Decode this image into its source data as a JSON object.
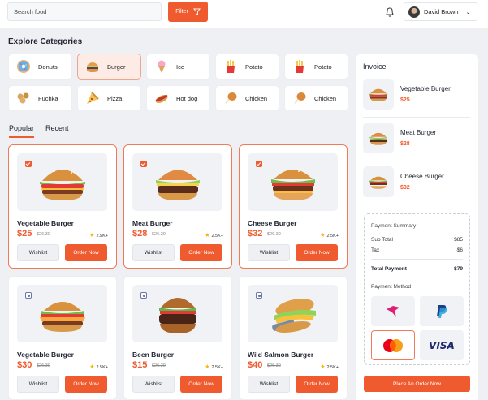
{
  "header": {
    "search_placeholder": "Search food",
    "filter_label": "Filter",
    "user_name": "David Brown"
  },
  "categories": {
    "title": "Explore Categories",
    "items": [
      {
        "label": "Donuts",
        "icon": "donut-icon",
        "active": false
      },
      {
        "label": "Burger",
        "icon": "burger-icon",
        "active": true
      },
      {
        "label": "Ice",
        "icon": "ice-cream-icon",
        "active": false
      },
      {
        "label": "Potato",
        "icon": "fries-icon",
        "active": false
      },
      {
        "label": "Potato",
        "icon": "fries-icon",
        "active": false
      },
      {
        "label": "Fuchka",
        "icon": "fuchka-icon",
        "active": false
      },
      {
        "label": "Pizza",
        "icon": "pizza-icon",
        "active": false
      },
      {
        "label": "Hot dog",
        "icon": "hot-dog-icon",
        "active": false
      },
      {
        "label": "Chicken",
        "icon": "chicken-icon",
        "active": false
      },
      {
        "label": "Chicken",
        "icon": "chicken-icon",
        "active": false
      }
    ]
  },
  "tabs": [
    {
      "label": "Popular",
      "active": true
    },
    {
      "label": "Recent",
      "active": false
    }
  ],
  "products": [
    {
      "name": "Vegetable Burger",
      "price": "$25",
      "old_price": "$26.30",
      "rating": "2.5K+",
      "checked": true,
      "wishlist": "Wishlist",
      "order": "Order Now"
    },
    {
      "name": "Meat Burger",
      "price": "$28",
      "old_price": "$26.30",
      "rating": "2.5K+",
      "checked": true,
      "wishlist": "Wishlist",
      "order": "Order Now"
    },
    {
      "name": "Cheese Burger",
      "price": "$32",
      "old_price": "$26.30",
      "rating": "2.5K+",
      "checked": true,
      "wishlist": "Wishlist",
      "order": "Order Now"
    },
    {
      "name": "Vegetable Burger",
      "price": "$30",
      "old_price": "$26.30",
      "rating": "2.5K+",
      "checked": false,
      "wishlist": "Wishlist",
      "order": "Order Now"
    },
    {
      "name": "Been Burger",
      "price": "$15",
      "old_price": "$26.30",
      "rating": "2.5K+",
      "checked": false,
      "wishlist": "Wishlist",
      "order": "Order Now"
    },
    {
      "name": "Wild Salmon Burger",
      "price": "$40",
      "old_price": "$26.30",
      "rating": "2.5K+",
      "checked": false,
      "wishlist": "Wishlist",
      "order": "Order Now"
    }
  ],
  "invoice": {
    "title": "Invoice",
    "items": [
      {
        "name": "Vegetable Burger",
        "price": "$25"
      },
      {
        "name": "Meat Burger",
        "price": "$28"
      },
      {
        "name": "Cheese Burger",
        "price": "$32"
      }
    ],
    "summary": {
      "title": "Payment Summary",
      "sub_total_label": "Sub Total",
      "sub_total_value": "$85",
      "tax_label": "Tax",
      "tax_value": "-$6",
      "total_label": "Total Payment",
      "total_value": "$79"
    },
    "payment_method_title": "Payment Method",
    "payment_methods": [
      {
        "name": "bird-pay-icon",
        "selected": false
      },
      {
        "name": "paypal-icon",
        "selected": false
      },
      {
        "name": "mastercard-icon",
        "selected": true
      },
      {
        "name": "visa-icon",
        "label": "VISA",
        "selected": false
      }
    ],
    "place_order_label": "Place An Order Now"
  },
  "colors": {
    "accent": "#ef5a2f",
    "background": "#eef0f4",
    "card": "#ffffff"
  }
}
